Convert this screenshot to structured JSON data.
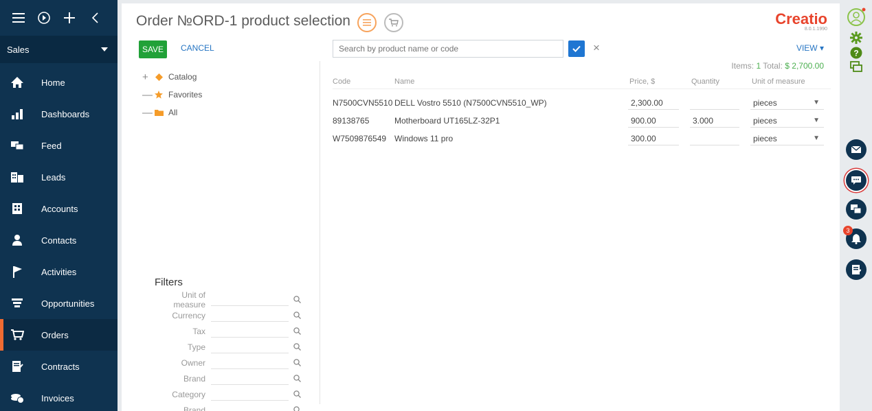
{
  "sidebar": {
    "workspace": "Sales",
    "items": [
      {
        "label": "Home"
      },
      {
        "label": "Dashboards"
      },
      {
        "label": "Feed"
      },
      {
        "label": "Leads"
      },
      {
        "label": "Accounts"
      },
      {
        "label": "Contacts"
      },
      {
        "label": "Activities"
      },
      {
        "label": "Opportunities"
      },
      {
        "label": "Orders",
        "active": true
      },
      {
        "label": "Contracts"
      },
      {
        "label": "Invoices"
      }
    ]
  },
  "header": {
    "title": "Order №ORD-1 product selection",
    "logo": "Creatio",
    "version": "8.0.1.1990"
  },
  "toolbar": {
    "save_label": "SAVE",
    "cancel_label": "CANCEL",
    "view_label": "VIEW"
  },
  "search": {
    "placeholder": "Search by product name or code"
  },
  "totals": {
    "items_label": "Items:",
    "items_count": "1",
    "total_label": "Total:",
    "total_value": "$ 2,700.00"
  },
  "tree": [
    {
      "toggle": "+",
      "label": "Catalog"
    },
    {
      "toggle": "—",
      "label": "Favorites"
    },
    {
      "toggle": "—",
      "label": "All"
    }
  ],
  "filters": {
    "title": "Filters",
    "items": [
      "Unit of measure",
      "Currency",
      "Tax",
      "Type",
      "Owner",
      "Brand",
      "Category",
      "Brand"
    ]
  },
  "table": {
    "columns": [
      "Code",
      "Name",
      "Price, $",
      "Quantity",
      "Unit of measure"
    ],
    "rows": [
      {
        "code": "N7500CVN5510",
        "name": "DELL Vostro 5510 (N7500CVN5510_WP)",
        "price": "2,300.00",
        "quantity": "",
        "unit": "pieces"
      },
      {
        "code": "89138765",
        "name": "Motherboard UT165LZ-32P1",
        "price": "900.00",
        "quantity": "3.000",
        "unit": "pieces"
      },
      {
        "code": "W7509876549",
        "name": "Windows 11 pro",
        "price": "300.00",
        "quantity": "",
        "unit": "pieces"
      }
    ]
  },
  "rightbar": {
    "notification_count": "3"
  },
  "colors": {
    "sidebar_bg": "#0f3350",
    "accent_orange": "#ef6b32",
    "save_green": "#21a138",
    "link_blue": "#2675c3",
    "brand_red": "#e8442c"
  }
}
